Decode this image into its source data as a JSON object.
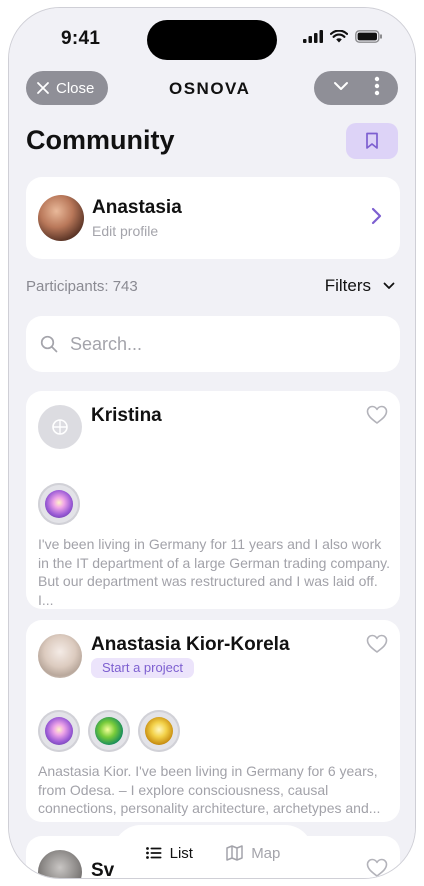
{
  "status_bar": {
    "time": "9:41"
  },
  "top_bar": {
    "close_label": "Close",
    "logo": "OSNOVA"
  },
  "page": {
    "title": "Community"
  },
  "profile": {
    "name": "Anastasia",
    "subtitle": "Edit profile"
  },
  "participants_label": "Participants: 743",
  "filters_label": "Filters",
  "search": {
    "placeholder": "Search..."
  },
  "members": [
    {
      "name": "Kristina",
      "bio": "I've been living in Germany for 11 years and I also work in the IT department of a large German trading company. But our department was restructured and I was laid off. I...",
      "badges": [
        "purple-orb-badge"
      ]
    },
    {
      "name": "Anastasia Kior-Korela",
      "tag": "Start a project",
      "bio": "Anastasia Kior. I've been living in Germany for 6 years, from Odesa. – I explore consciousness, causal connections, personality architecture, archetypes and...",
      "badges": [
        "purple-orb-badge",
        "green-orb-badge",
        "gold-orb-badge"
      ]
    },
    {
      "name": "Sv"
    }
  ],
  "bottom_nav": {
    "list_label": "List",
    "map_label": "Map"
  },
  "colors": {
    "accent": "#7d5fd0",
    "accent_bg": "#ddd3f7",
    "background": "#f1f1f6"
  }
}
